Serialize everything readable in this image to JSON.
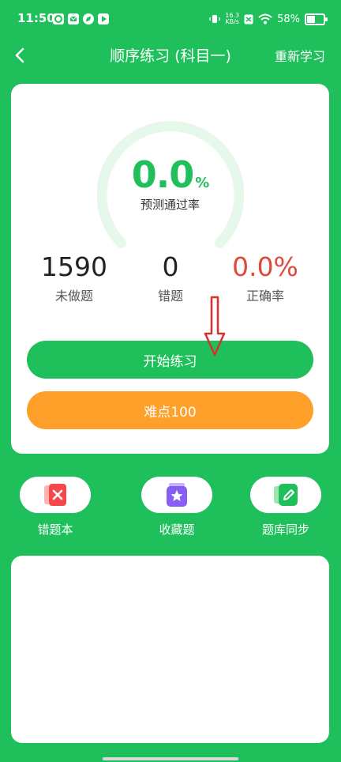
{
  "status_bar": {
    "time": "11:50",
    "net_speed_value": "16.3",
    "net_speed_unit": "KB/s",
    "battery_percent": "58%",
    "battery_level": 0.58,
    "icons": [
      "app-icon-1",
      "mail-icon",
      "leaf-icon",
      "play-icon",
      "vibrate-icon",
      "nfc-icon",
      "wifi-icon",
      "battery-icon"
    ]
  },
  "header": {
    "back_icon": "chevron-left-icon",
    "title": "顺序练习 (科目一)",
    "action_label": "重新学习"
  },
  "card": {
    "gauge": {
      "value": "0.0",
      "unit": "%",
      "label": "预测通过率",
      "progress": 0.0
    },
    "stats": [
      {
        "value": "1590",
        "label": "未做题"
      },
      {
        "value": "0",
        "label": "错题"
      },
      {
        "value": "0.0%",
        "label": "正确率"
      }
    ],
    "start_button_label": "开始练习",
    "hard_button_label": "难点100"
  },
  "shortcuts": [
    {
      "label": "错题本",
      "icon": "wrong-book-icon"
    },
    {
      "label": "收藏题",
      "icon": "favorites-icon"
    },
    {
      "label": "题库同步",
      "icon": "sync-edit-icon"
    }
  ],
  "colors": {
    "brand": "#1fc05c",
    "accent_orange": "#ffa02b",
    "danger": "#e2483a",
    "annotation_arrow": "#d9302b"
  }
}
